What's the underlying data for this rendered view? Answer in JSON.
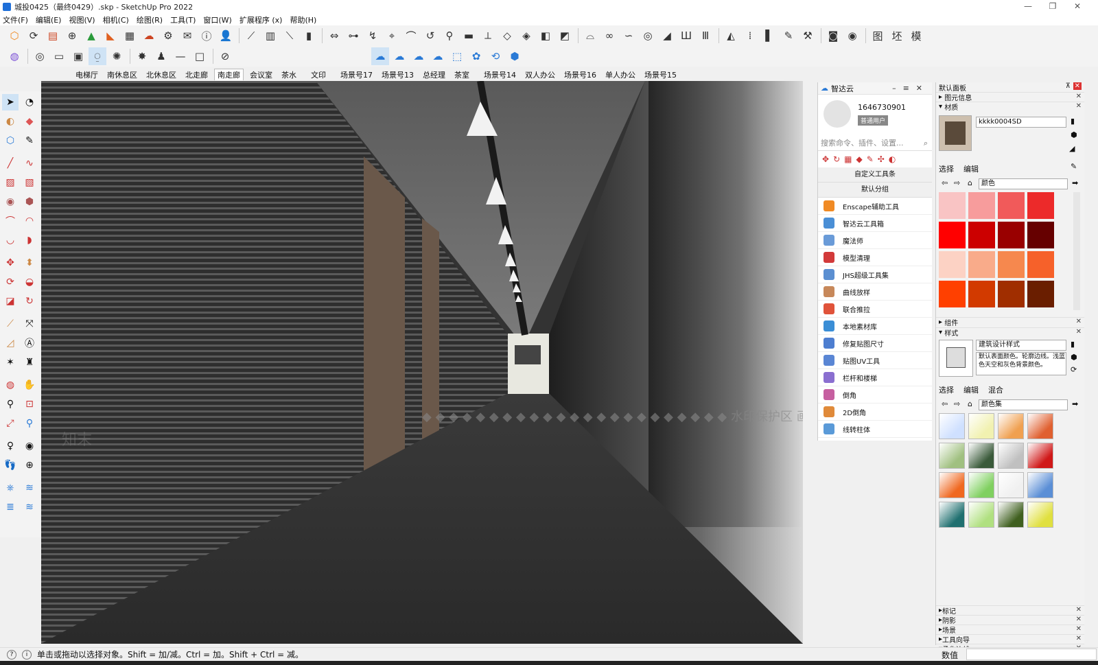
{
  "window": {
    "title": "城投0425（最终0429）.skp - SketchUp Pro 2022"
  },
  "menu": [
    "文件(F)",
    "编辑(E)",
    "视图(V)",
    "相机(C)",
    "绘图(R)",
    "工具(T)",
    "窗口(W)",
    "扩展程序 (x)",
    "帮助(H)"
  ],
  "toolbar_row1": [
    "logo-icon",
    "refresh-icon",
    "layers-icon",
    "plus-circle-icon",
    "tree-icon",
    "house-icon",
    "checker-icon",
    "cloud-up-icon",
    "gear-icon",
    "mail-icon",
    "info-icon",
    "person-icon",
    "stairs-icon",
    "table-icon",
    "ruler-icon",
    "bars-icon",
    "tool-a-icon",
    "tool-b-icon",
    "tool-c-icon",
    "tool-d-icon",
    "tool-e-icon",
    "tool-f-icon",
    "tool-g-icon",
    "tool-h-icon",
    "tool-i-icon",
    "tool-j-icon",
    "tool-k-icon",
    "tool-l-icon",
    "tool-m-icon",
    "tool-n-icon",
    "tool-o-icon",
    "tool-p-icon",
    "tool-q-icon",
    "tool-r-icon",
    "tool-s-icon",
    "tool-t-icon",
    "tool-u-icon",
    "tool-v-icon",
    "tool-w-icon",
    "tool-x-icon"
  ],
  "toolbar_row1_text": [
    "图",
    "坯",
    "模"
  ],
  "scenes": [
    "电梯厅",
    "南休息区",
    "北休息区",
    "北走廊",
    "南走廊",
    "会议室",
    "茶水",
    "文印",
    "场景号17",
    "场景号13",
    "总经理",
    "茶室",
    "场景号14",
    "双人办公",
    "场景号16",
    "单人办公",
    "场景号15"
  ],
  "active_scene": "南走廊",
  "viewport": {
    "watermark_line": "◆ ◆ ◆ ◆ ◆ ◆ ◆ ◆ ◆ ◆ ◆ ◆ ◆ ◆ ◆ ◆ ◆ ◆ ◆ ◆ ◆ ◆ ◆ 水印保护区   画质会受到部分影响",
    "watermark_logo": "知末"
  },
  "zhidayun": {
    "title": "智达云",
    "user_id": "1646730901",
    "user_badge": "普通用户",
    "search_placeholder": "搜索命令、插件、设置...",
    "section_custom": "自定义工具条",
    "section_default": "默认分组",
    "items": [
      {
        "label": "Enscape辅助工具",
        "color": "#f08a24"
      },
      {
        "label": "智达云工具箱",
        "color": "#4a8fd6"
      },
      {
        "label": "魔法师",
        "color": "#6a9bd8"
      },
      {
        "label": "模型清理",
        "color": "#d23a3a"
      },
      {
        "label": "JHS超级工具集",
        "color": "#5b8fd1"
      },
      {
        "label": "曲线放样",
        "color": "#c7885a"
      },
      {
        "label": "联合推拉",
        "color": "#e0533a"
      },
      {
        "label": "本地素材库",
        "color": "#3a8ed6"
      },
      {
        "label": "修复贴图尺寸",
        "color": "#4d7ed0"
      },
      {
        "label": "贴图UV工具",
        "color": "#5a86d4"
      },
      {
        "label": "栏杆和楼梯",
        "color": "#8a6fd0"
      },
      {
        "label": "倒角",
        "color": "#c65fa0"
      },
      {
        "label": "2D倒角",
        "color": "#e08a3a"
      },
      {
        "label": "线转柱体",
        "color": "#5a9ad8"
      }
    ]
  },
  "tray": {
    "title": "默认面板",
    "entity_info": "图元信息",
    "materials": "材质",
    "material_name": "kkkk0004SD",
    "select_tab": "选择",
    "edit_tab": "编辑",
    "mix_tab": "混合",
    "material_collection": "颜色",
    "material_swatches": [
      "#f9c4c4",
      "#f79c9c",
      "#f15a5a",
      "#ec2a2a",
      "#ff0000",
      "#cc0000",
      "#990000",
      "#660000",
      "#fcd2c4",
      "#f9ab8a",
      "#f6884e",
      "#f6612a",
      "#ff4000",
      "#d23a00",
      "#a02e00",
      "#6a1e00"
    ],
    "components": "组件",
    "styles": "样式",
    "style_name": "建筑设计样式",
    "style_desc": "默认表面颜色。轮廓边线。浅蓝色天空和灰色背景颜色。",
    "style_collection": "颜色集",
    "style_thumbs": [
      "#cfe0ff",
      "#f1f1b0",
      "#f0a050",
      "#e06030",
      "#a0c080",
      "#3a5a3a",
      "#c0c0c0",
      "#d01818",
      "#f06820",
      "#80d060",
      "#f0f0f0",
      "#5b8fd6",
      "#207070",
      "#b0e080",
      "#406020",
      "#e0e040"
    ],
    "collapsed": [
      "标记",
      "阴影",
      "场景",
      "工具向导",
      "柔化边线"
    ]
  },
  "status": {
    "text": "单击或拖动以选择对象。Shift = 加/减。Ctrl = 加。Shift + Ctrl = 减。",
    "measure_label": "数值"
  }
}
